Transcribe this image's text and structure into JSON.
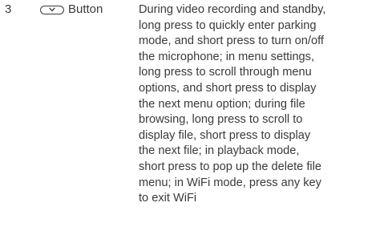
{
  "row": {
    "number": "3",
    "button_icon": "chevron-down-pill-icon",
    "button_label": "Button",
    "description_lines": [
      "During video recording and standby,",
      "long press to quickly enter parking",
      "mode, and short press to turn on/off",
      "the microphone; in menu settings,",
      "long press to scroll through menu",
      "options, and short press to display",
      "the next menu option; during file",
      "browsing, long press to scroll to",
      "display file, short press to display",
      "the next file; in playback mode,",
      "short press to pop up the delete file",
      "menu; in WiFi mode, press any key",
      "to exit WiFi"
    ]
  }
}
